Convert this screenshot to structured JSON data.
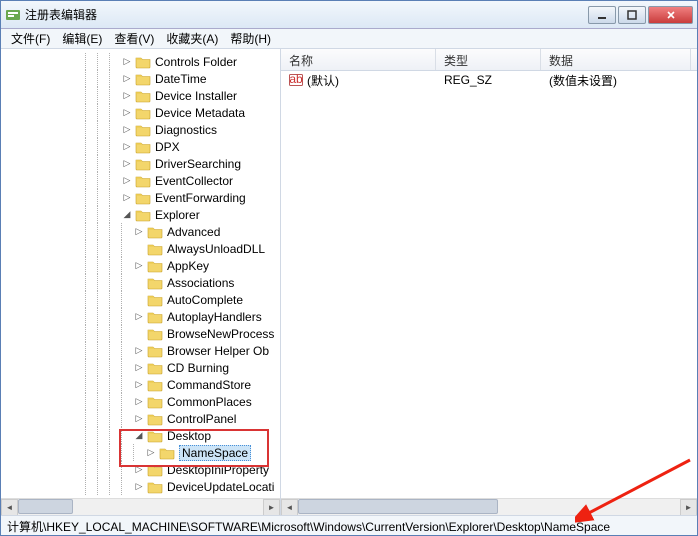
{
  "window": {
    "title": "注册表编辑器"
  },
  "menu": {
    "file": "文件(F)",
    "edit": "编辑(E)",
    "view": "查看(V)",
    "favorites": "收藏夹(A)",
    "help": "帮助(H)"
  },
  "tree": {
    "items": [
      {
        "label": "Controls Folder",
        "depth": 10,
        "exp": "r"
      },
      {
        "label": "DateTime",
        "depth": 10,
        "exp": "r"
      },
      {
        "label": "Device Installer",
        "depth": 10,
        "exp": "r"
      },
      {
        "label": "Device Metadata",
        "depth": 10,
        "exp": "r"
      },
      {
        "label": "Diagnostics",
        "depth": 10,
        "exp": "r"
      },
      {
        "label": "DPX",
        "depth": 10,
        "exp": "r"
      },
      {
        "label": "DriverSearching",
        "depth": 10,
        "exp": "r"
      },
      {
        "label": "EventCollector",
        "depth": 10,
        "exp": "r"
      },
      {
        "label": "EventForwarding",
        "depth": 10,
        "exp": "r"
      },
      {
        "label": "Explorer",
        "depth": 10,
        "exp": "d"
      },
      {
        "label": "Advanced",
        "depth": 11,
        "exp": "r"
      },
      {
        "label": "AlwaysUnloadDLL",
        "depth": 11,
        "exp": ""
      },
      {
        "label": "AppKey",
        "depth": 11,
        "exp": "r"
      },
      {
        "label": "Associations",
        "depth": 11,
        "exp": ""
      },
      {
        "label": "AutoComplete",
        "depth": 11,
        "exp": ""
      },
      {
        "label": "AutoplayHandlers",
        "depth": 11,
        "exp": "r"
      },
      {
        "label": "BrowseNewProcess",
        "depth": 11,
        "exp": ""
      },
      {
        "label": "Browser Helper Ob",
        "depth": 11,
        "exp": "r"
      },
      {
        "label": "CD Burning",
        "depth": 11,
        "exp": "r"
      },
      {
        "label": "CommandStore",
        "depth": 11,
        "exp": "r"
      },
      {
        "label": "CommonPlaces",
        "depth": 11,
        "exp": "r"
      },
      {
        "label": "ControlPanel",
        "depth": 11,
        "exp": "r"
      },
      {
        "label": "Desktop",
        "depth": 11,
        "exp": "d"
      },
      {
        "label": "NameSpace",
        "depth": 12,
        "exp": "r",
        "selected": true
      },
      {
        "label": "DesktopIniProperty",
        "depth": 11,
        "exp": "r"
      },
      {
        "label": "DeviceUpdateLocati",
        "depth": 11,
        "exp": "r"
      }
    ]
  },
  "list": {
    "cols": {
      "name": "名称",
      "type": "类型",
      "data": "数据"
    },
    "rows": [
      {
        "name": "(默认)",
        "type": "REG_SZ",
        "data": "(数值未设置)"
      }
    ]
  },
  "status": {
    "path": "计算机\\HKEY_LOCAL_MACHINE\\SOFTWARE\\Microsoft\\Windows\\CurrentVersion\\Explorer\\Desktop\\NameSpace"
  },
  "col_widths": {
    "name": 155,
    "type": 105,
    "data": 150
  }
}
